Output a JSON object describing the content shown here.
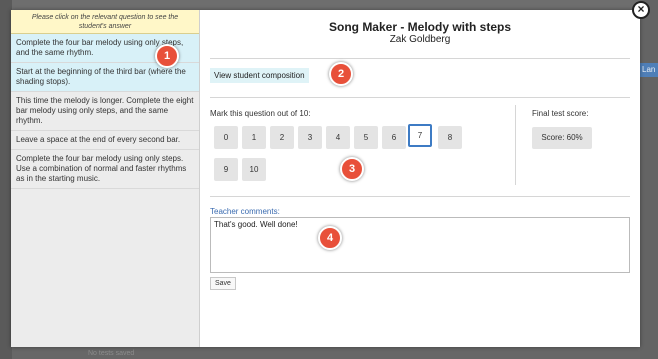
{
  "background": {
    "right_tab_text": "Lan",
    "bottom_text": "No tests saved"
  },
  "close_icon": "×",
  "sidebar": {
    "header": "Please click on the relevant question to see the student's answer",
    "questions": [
      {
        "text": "Complete the four bar melody using only steps, and the same rhythm.",
        "selected": true
      },
      {
        "text": "Start at the beginning of the third bar (where the shading stops).",
        "selected": true
      },
      {
        "text": "This time the melody is longer. Complete the eight bar melody using only steps, and the same rhythm.",
        "selected": false
      },
      {
        "text": "Leave a space at the end of every second bar.",
        "selected": false
      },
      {
        "text": "Complete the four bar melody using only steps. Use a combination of normal and faster rhythms as in the starting music.",
        "selected": false
      }
    ]
  },
  "main": {
    "title": "Song Maker - Melody with steps",
    "student_name": "Zak Goldberg",
    "view_composition_label": "View student composition",
    "mark_label": "Mark this question out of 10:",
    "marks": [
      "0",
      "1",
      "2",
      "3",
      "4",
      "5",
      "6",
      "7",
      "8",
      "9",
      "10"
    ],
    "selected_mark": "7",
    "final_score_label": "Final test score:",
    "final_score_value": "Score: 60%",
    "comments_label": "Teacher comments:",
    "comments_value": "That's good. Well done!",
    "save_label": "Save"
  },
  "callouts": [
    "1",
    "2",
    "3",
    "4"
  ],
  "colors": {
    "accent_blue": "#3d7bc4",
    "callout_red": "#e8503a",
    "selected_row": "#d8f1f8",
    "header_yellow": "#fff7c8"
  }
}
